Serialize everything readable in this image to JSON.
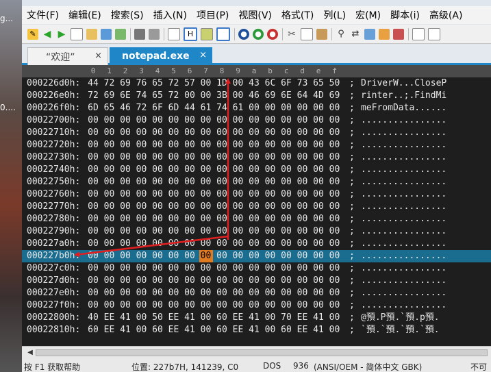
{
  "desktop": {
    "snippets": [
      "g...",
      "0...."
    ]
  },
  "menu": [
    "文件(F)",
    "编辑(E)",
    "搜索(S)",
    "插入(N)",
    "项目(P)",
    "视图(V)",
    "格式(T)",
    "列(L)",
    "宏(M)",
    "脚本(i)",
    "高级(A)"
  ],
  "tabs": [
    {
      "label": "“欢迎”",
      "close": "×",
      "active": false
    },
    {
      "label": "notepad.exe",
      "close": "×",
      "active": true
    }
  ],
  "ruler": [
    "0",
    "1",
    "2",
    "3",
    "4",
    "5",
    "6",
    "7",
    "8",
    "9",
    "a",
    "b",
    "c",
    "d",
    "e",
    "f"
  ],
  "rows": [
    {
      "addr": "000226d0h:",
      "bytes": [
        "44",
        "72",
        "69",
        "76",
        "65",
        "72",
        "57",
        "00",
        "1D",
        "00",
        "43",
        "6C",
        "6F",
        "73",
        "65",
        "50"
      ],
      "ascii": "DriverW...CloseP"
    },
    {
      "addr": "000226e0h:",
      "bytes": [
        "72",
        "69",
        "6E",
        "74",
        "65",
        "72",
        "00",
        "00",
        "3B",
        "00",
        "46",
        "69",
        "6E",
        "64",
        "4D",
        "69"
      ],
      "ascii": "rinter..;.FindMi"
    },
    {
      "addr": "000226f0h:",
      "bytes": [
        "6D",
        "65",
        "46",
        "72",
        "6F",
        "6D",
        "44",
        "61",
        "74",
        "61",
        "00",
        "00",
        "00",
        "00",
        "00",
        "00"
      ],
      "ascii": "meFromData......"
    },
    {
      "addr": "00022700h:",
      "bytes": [
        "00",
        "00",
        "00",
        "00",
        "00",
        "00",
        "00",
        "00",
        "00",
        "00",
        "00",
        "00",
        "00",
        "00",
        "00",
        "00"
      ],
      "ascii": "................"
    },
    {
      "addr": "00022710h:",
      "bytes": [
        "00",
        "00",
        "00",
        "00",
        "00",
        "00",
        "00",
        "00",
        "00",
        "00",
        "00",
        "00",
        "00",
        "00",
        "00",
        "00"
      ],
      "ascii": "................"
    },
    {
      "addr": "00022720h:",
      "bytes": [
        "00",
        "00",
        "00",
        "00",
        "00",
        "00",
        "00",
        "00",
        "00",
        "00",
        "00",
        "00",
        "00",
        "00",
        "00",
        "00"
      ],
      "ascii": "................"
    },
    {
      "addr": "00022730h:",
      "bytes": [
        "00",
        "00",
        "00",
        "00",
        "00",
        "00",
        "00",
        "00",
        "00",
        "00",
        "00",
        "00",
        "00",
        "00",
        "00",
        "00"
      ],
      "ascii": "................"
    },
    {
      "addr": "00022740h:",
      "bytes": [
        "00",
        "00",
        "00",
        "00",
        "00",
        "00",
        "00",
        "00",
        "00",
        "00",
        "00",
        "00",
        "00",
        "00",
        "00",
        "00"
      ],
      "ascii": "................"
    },
    {
      "addr": "00022750h:",
      "bytes": [
        "00",
        "00",
        "00",
        "00",
        "00",
        "00",
        "00",
        "00",
        "00",
        "00",
        "00",
        "00",
        "00",
        "00",
        "00",
        "00"
      ],
      "ascii": "................"
    },
    {
      "addr": "00022760h:",
      "bytes": [
        "00",
        "00",
        "00",
        "00",
        "00",
        "00",
        "00",
        "00",
        "00",
        "00",
        "00",
        "00",
        "00",
        "00",
        "00",
        "00"
      ],
      "ascii": "................"
    },
    {
      "addr": "00022770h:",
      "bytes": [
        "00",
        "00",
        "00",
        "00",
        "00",
        "00",
        "00",
        "00",
        "00",
        "00",
        "00",
        "00",
        "00",
        "00",
        "00",
        "00"
      ],
      "ascii": "................"
    },
    {
      "addr": "00022780h:",
      "bytes": [
        "00",
        "00",
        "00",
        "00",
        "00",
        "00",
        "00",
        "00",
        "00",
        "00",
        "00",
        "00",
        "00",
        "00",
        "00",
        "00"
      ],
      "ascii": "................"
    },
    {
      "addr": "00022790h:",
      "bytes": [
        "00",
        "00",
        "00",
        "00",
        "00",
        "00",
        "00",
        "00",
        "00",
        "00",
        "00",
        "00",
        "00",
        "00",
        "00",
        "00"
      ],
      "ascii": "................"
    },
    {
      "addr": "000227a0h:",
      "bytes": [
        "00",
        "00",
        "00",
        "00",
        "00",
        "00",
        "00",
        "00",
        "00",
        "00",
        "00",
        "00",
        "00",
        "00",
        "00",
        "00"
      ],
      "ascii": "................"
    },
    {
      "addr": "000227b0h:",
      "bytes": [
        "00",
        "00",
        "00",
        "00",
        "00",
        "00",
        "00",
        "00",
        "00",
        "00",
        "00",
        "00",
        "00",
        "00",
        "00",
        "00"
      ],
      "ascii": "................",
      "selected": true,
      "cursor_col": 7
    },
    {
      "addr": "000227c0h:",
      "bytes": [
        "00",
        "00",
        "00",
        "00",
        "00",
        "00",
        "00",
        "00",
        "00",
        "00",
        "00",
        "00",
        "00",
        "00",
        "00",
        "00"
      ],
      "ascii": "................"
    },
    {
      "addr": "000227d0h:",
      "bytes": [
        "00",
        "00",
        "00",
        "00",
        "00",
        "00",
        "00",
        "00",
        "00",
        "00",
        "00",
        "00",
        "00",
        "00",
        "00",
        "00"
      ],
      "ascii": "................"
    },
    {
      "addr": "000227e0h:",
      "bytes": [
        "00",
        "00",
        "00",
        "00",
        "00",
        "00",
        "00",
        "00",
        "00",
        "00",
        "00",
        "00",
        "00",
        "00",
        "00",
        "00"
      ],
      "ascii": "................"
    },
    {
      "addr": "000227f0h:",
      "bytes": [
        "00",
        "00",
        "00",
        "00",
        "00",
        "00",
        "00",
        "00",
        "00",
        "00",
        "00",
        "00",
        "00",
        "00",
        "00",
        "00"
      ],
      "ascii": "................"
    },
    {
      "addr": "00022800h:",
      "bytes": [
        "40",
        "EE",
        "41",
        "00",
        "50",
        "EE",
        "41",
        "00",
        "60",
        "EE",
        "41",
        "00",
        "70",
        "EE",
        "41",
        "00"
      ],
      "ascii": "@預.P預.`預.p預."
    },
    {
      "addr": "00022810h:",
      "bytes": [
        "60",
        "EE",
        "41",
        "00",
        "60",
        "EE",
        "41",
        "00",
        "60",
        "EE",
        "41",
        "00",
        "60",
        "EE",
        "41",
        "00"
      ],
      "ascii": "`預.`預.`預.`預."
    }
  ],
  "status": {
    "help": "按 F1 获取帮助",
    "position": "位置: 227b7H, 141239, C0",
    "format": "DOS",
    "codepage": "936",
    "encoding": "(ANSI/OEM - 简体中文 GBK)",
    "extra": "不可"
  },
  "colors": {
    "tab_active": "#1f87c8",
    "selected_row": "#1b6d8f",
    "annotation_arrow": "#e02020",
    "cursor_byte": "#e07a20"
  },
  "toolbar_icons": [
    "new-file-icon",
    "back-icon",
    "forward-icon",
    "blank-doc-icon",
    "open-folder-icon",
    "folder-icon",
    "image-icon",
    "print-icon",
    "print-preview-icon",
    "properties-icon",
    "hex-mode-icon",
    "column-icon",
    "list-icon",
    "browser-1-icon",
    "browser-2-icon",
    "browser-3-icon",
    "cut-icon",
    "copy-icon",
    "paste-icon",
    "find-icon",
    "replace-icon",
    "find-in-files-icon",
    "table-icon",
    "list-view-icon",
    "window-icon",
    "panel-icon"
  ]
}
